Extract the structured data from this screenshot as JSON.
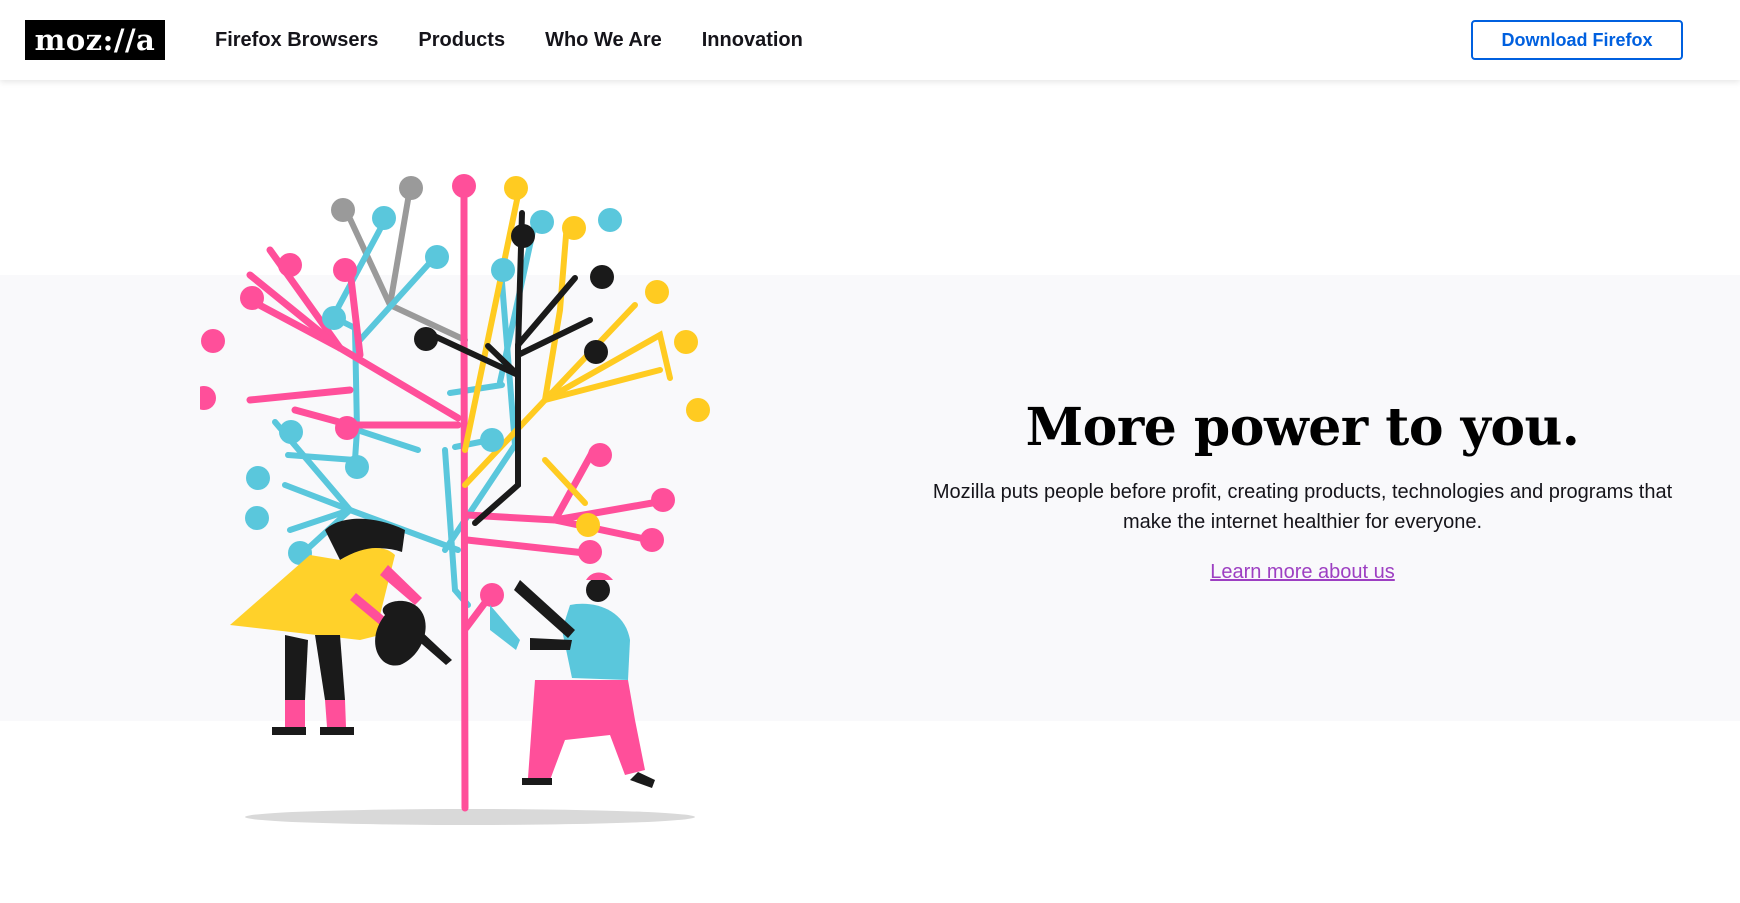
{
  "header": {
    "logo_text": "moz://a",
    "nav": [
      {
        "label": "Firefox Browsers"
      },
      {
        "label": "Products"
      },
      {
        "label": "Who We Are"
      },
      {
        "label": "Innovation"
      }
    ],
    "download_label": "Download Firefox"
  },
  "hero": {
    "title": "More power to you.",
    "description_line1": "Mozilla puts people before profit, creating products, technologies and programs that",
    "description_line2": "make the internet healthier for everyone.",
    "link_label": "Learn more about us",
    "illustration": "tree-with-gardeners-illustration"
  },
  "colors": {
    "brand_black": "#000000",
    "button_blue": "#0060df",
    "link_purple": "#9d3fc2",
    "band_bg": "#f9f9fb",
    "pink": "#ff4f9a",
    "cyan": "#5ac7dc",
    "yellow": "#ffcb21",
    "gray": "#9a9a9a",
    "dark": "#1a1a1a"
  }
}
